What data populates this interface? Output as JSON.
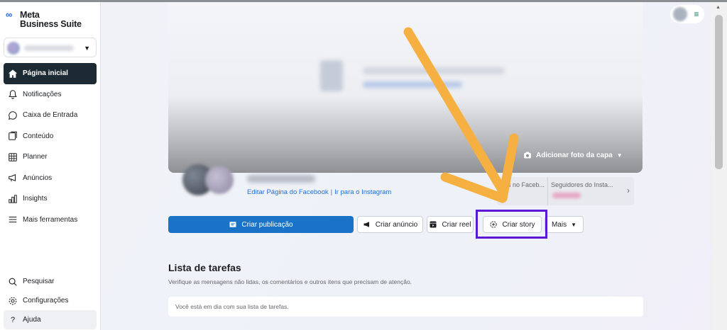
{
  "brand": {
    "line1": "Meta",
    "line2": "Business Suite"
  },
  "sidebar": {
    "items": [
      {
        "label": "Página inicial",
        "icon": "home-icon",
        "active": true
      },
      {
        "label": "Notificações",
        "icon": "bell-icon"
      },
      {
        "label": "Caixa de Entrada",
        "icon": "chat-bubble-icon"
      },
      {
        "label": "Conteúdo",
        "icon": "content-icon"
      },
      {
        "label": "Planner",
        "icon": "calendar-grid-icon"
      },
      {
        "label": "Anúncios",
        "icon": "megaphone-icon"
      },
      {
        "label": "Insights",
        "icon": "bar-chart-icon"
      },
      {
        "label": "Mais ferramentas",
        "icon": "hamburger-menu-icon"
      }
    ],
    "bottom": [
      {
        "label": "Pesquisar",
        "icon": "search-icon"
      },
      {
        "label": "Configurações",
        "icon": "gear-icon"
      },
      {
        "label": "Ajuda",
        "icon": "help-icon"
      }
    ]
  },
  "cover": {
    "add_cover_label": "Adicionar foto da capa"
  },
  "profile": {
    "edit_link": "Editar Página do Facebook",
    "separator": "|",
    "instagram_link": "Ir para o Instagram"
  },
  "stats": {
    "facebook_label": "s no Faceb...",
    "instagram_label": "Seguidores do Insta..."
  },
  "actions": {
    "create_post": "Criar publicação",
    "create_ad": "Criar anúncio",
    "create_reel": "Criar reel",
    "create_story": "Criar story",
    "more": "Mais"
  },
  "tasks": {
    "title": "Lista de tarefas",
    "subtitle": "Verifique as mensagens não lidas, os comentários e outros itens que precisam de atenção.",
    "empty_message": "Você está em dia com sua lista de tarefas."
  },
  "colors": {
    "primary": "#1a73c6",
    "active_nav": "#1c2b33",
    "highlight": "#5a17d6",
    "arrow": "#f5b041"
  }
}
